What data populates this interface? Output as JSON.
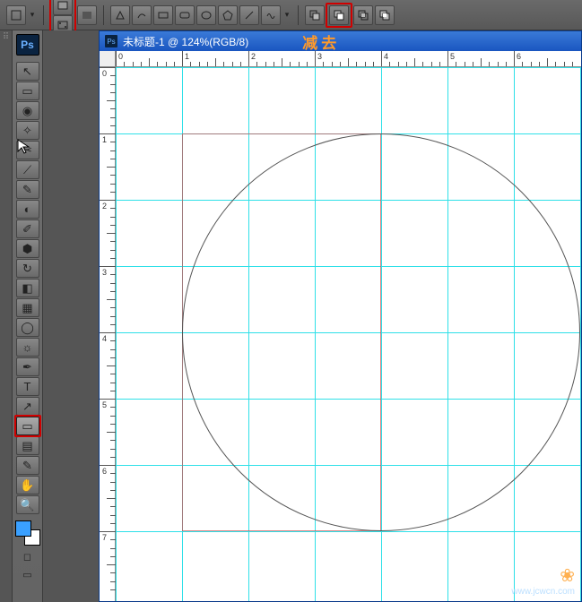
{
  "topbar": {
    "shape_mode": "rect",
    "path_modes": [
      "shape-layer",
      "paths",
      "fill-pixels"
    ],
    "tools": [
      "pen",
      "freeform-pen",
      "rect",
      "rounded-rect",
      "ellipse",
      "polygon",
      "line",
      "custom"
    ],
    "combine": [
      "add",
      "subtract",
      "intersect",
      "exclude"
    ]
  },
  "app": {
    "badge": "Ps"
  },
  "doc": {
    "title": "未标题-1 @ 124%(RGB/8)",
    "annotation": "减去"
  },
  "ruler": {
    "h": [
      "0",
      "1",
      "2",
      "3",
      "4",
      "5",
      "6"
    ],
    "v": [
      "0",
      "1",
      "2",
      "3",
      "4",
      "5",
      "6",
      "7"
    ]
  },
  "watermark": "www.jcwcn.com",
  "tools": [
    {
      "name": "move",
      "glyph": "↖"
    },
    {
      "name": "marquee",
      "glyph": "▭"
    },
    {
      "name": "lasso",
      "glyph": "◉"
    },
    {
      "name": "magic-wand",
      "glyph": "✧"
    },
    {
      "name": "crop",
      "glyph": "✂"
    },
    {
      "name": "slice",
      "glyph": "⟋"
    },
    {
      "name": "eyedropper",
      "glyph": "✎"
    },
    {
      "name": "healing",
      "glyph": "◐"
    },
    {
      "name": "brush",
      "glyph": "✐"
    },
    {
      "name": "stamp",
      "glyph": "⬢"
    },
    {
      "name": "history-brush",
      "glyph": "↻"
    },
    {
      "name": "eraser",
      "glyph": "◧"
    },
    {
      "name": "gradient",
      "glyph": "▦"
    },
    {
      "name": "blur",
      "glyph": "◯"
    },
    {
      "name": "dodge",
      "glyph": "☼"
    },
    {
      "name": "pen",
      "glyph": "✒"
    },
    {
      "name": "type",
      "glyph": "T"
    },
    {
      "name": "path-select",
      "glyph": "↗"
    },
    {
      "name": "shape",
      "glyph": "▭",
      "hi": true,
      "sel": true
    },
    {
      "name": "notes",
      "glyph": "▤"
    },
    {
      "name": "eyedrop2",
      "glyph": "✎"
    },
    {
      "name": "hand",
      "glyph": "✋"
    },
    {
      "name": "zoom",
      "glyph": "🔍"
    }
  ]
}
